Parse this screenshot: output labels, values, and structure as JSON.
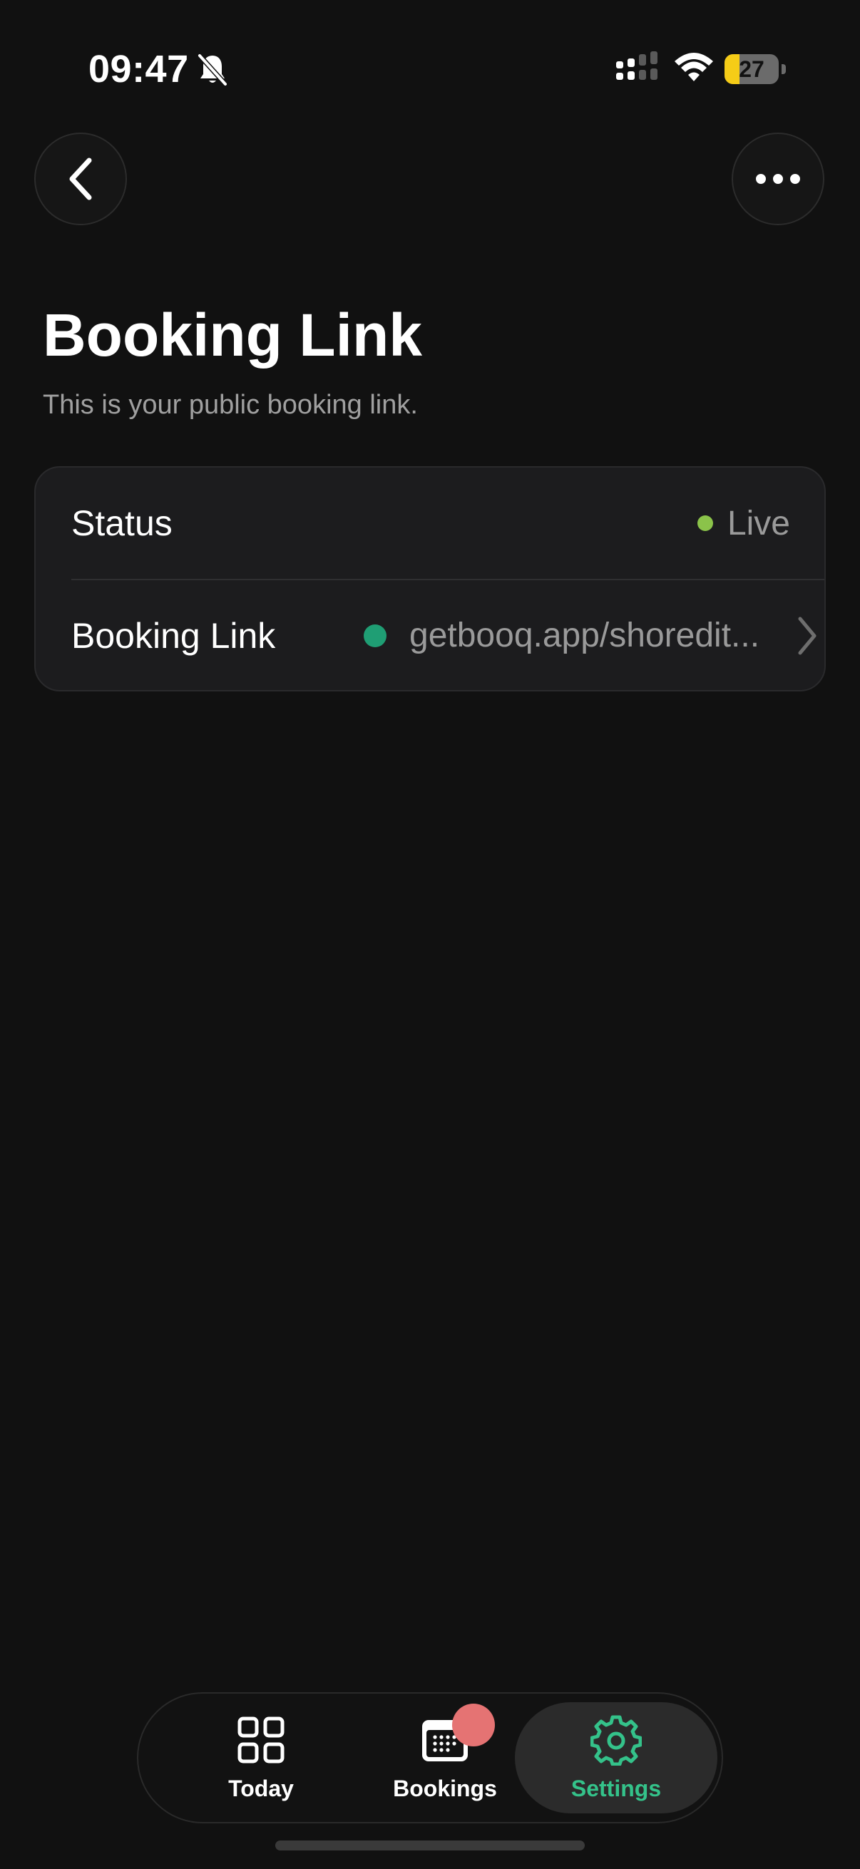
{
  "status_bar": {
    "time": "09:47",
    "battery_level": "27",
    "battery_fraction": 0.27,
    "icons": [
      "bell-slash-icon",
      "cellular-signal-icon",
      "wifi-icon",
      "battery-icon"
    ]
  },
  "nav": {
    "back_icon": "chevron-left-icon",
    "more_icon": "ellipsis-icon"
  },
  "header": {
    "title": "Booking Link",
    "subtitle": "This is your public booking link."
  },
  "card": {
    "status_label": "Status",
    "status_value": "Live",
    "status_color": "#8bc34a",
    "link_label": "Booking Link",
    "link_value": "getbooq.app/shoredit...",
    "link_dot_color": "#1f9e74"
  },
  "tabs": [
    {
      "label": "Today",
      "icon": "grid-icon",
      "active": false
    },
    {
      "label": "Bookings",
      "icon": "calendar-icon",
      "active": false,
      "badge": true
    },
    {
      "label": "Settings",
      "icon": "gear-icon",
      "active": true
    }
  ],
  "colors": {
    "background": "#111111",
    "card": "#1c1c1e",
    "accent": "#34c28a",
    "badge": "#e57373"
  }
}
